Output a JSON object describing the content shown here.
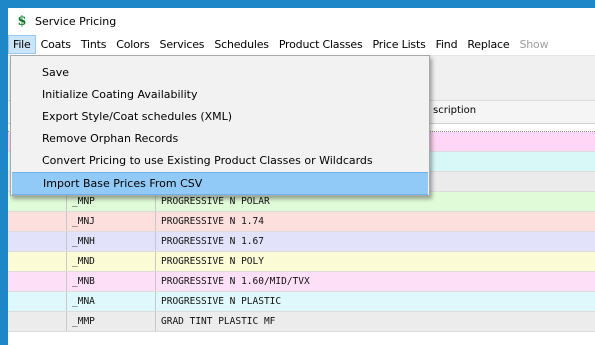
{
  "window": {
    "title": "Service Pricing",
    "icon": "dollar-icon"
  },
  "menubar": {
    "items": [
      "File",
      "Coats",
      "Tints",
      "Colors",
      "Services",
      "Schedules",
      "Product Classes",
      "Price Lists",
      "Find",
      "Replace",
      "Show"
    ],
    "active": "File"
  },
  "file_menu": {
    "items": [
      "Save",
      "Initialize Coating Availability",
      "Export Style/Coat schedules (XML)",
      "Remove Orphan Records",
      "Convert Pricing to use Existing Product Classes or Wildcards",
      "Import Base Prices From CSV"
    ],
    "highlighted": "Import Base Prices From CSV"
  },
  "grid": {
    "description_header": "scription",
    "rows": [
      {
        "code": "",
        "description": "",
        "color": "#ffd6f5"
      },
      {
        "code": "",
        "description": "",
        "color": "#d8f7f7"
      },
      {
        "code": "",
        "description": "",
        "color": "#ebebeb"
      },
      {
        "code": "_MNP",
        "description": "PROGRESSIVE N POLAR",
        "color": "#e0fbd8"
      },
      {
        "code": "_MNJ",
        "description": "PROGRESSIVE N 1.74",
        "color": "#fde0de"
      },
      {
        "code": "_MNH",
        "description": "PROGRESSIVE N 1.67",
        "color": "#e2e2fb"
      },
      {
        "code": "_MND",
        "description": "PROGRESSIVE N POLY",
        "color": "#fbfbd6"
      },
      {
        "code": "_MNB",
        "description": "PROGRESSIVE N 1.60/MID/TVX",
        "color": "#fde0f8"
      },
      {
        "code": "_MNA",
        "description": "PROGRESSIVE N PLASTIC",
        "color": "#def8fb"
      },
      {
        "code": "_MMP",
        "description": "GRAD TINT PLASTIC MF",
        "color": "#ececec"
      }
    ]
  },
  "colors": {
    "desktop": "#1e87c8",
    "menu_highlight": "#91c9f7",
    "active_menu": "#cce4f7"
  }
}
